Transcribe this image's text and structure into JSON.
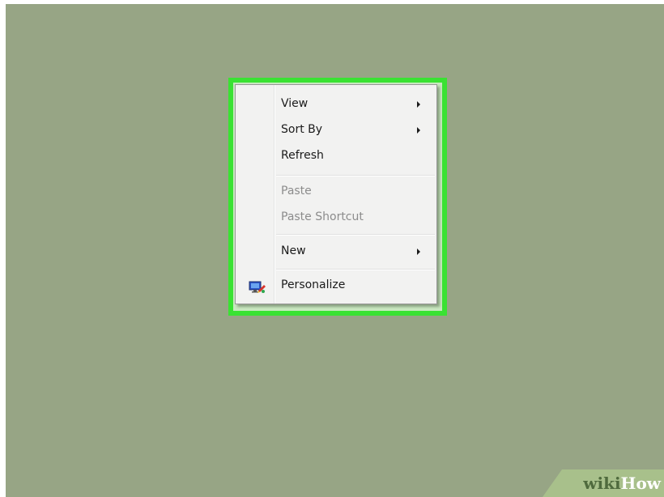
{
  "context_menu": {
    "items": [
      {
        "label": "View",
        "enabled": true,
        "submenu": true
      },
      {
        "label": "Sort By",
        "enabled": true,
        "submenu": true
      },
      {
        "label": "Refresh",
        "enabled": true,
        "submenu": false
      },
      {
        "label": "Paste",
        "enabled": false,
        "submenu": false
      },
      {
        "label": "Paste Shortcut",
        "enabled": false,
        "submenu": false
      },
      {
        "label": "New",
        "enabled": true,
        "submenu": true
      },
      {
        "label": "Personalize",
        "enabled": true,
        "submenu": false,
        "icon": "personalize-icon"
      }
    ]
  },
  "watermark": {
    "wiki": "wiki",
    "how": "How"
  },
  "colors": {
    "desktop": "#97a585",
    "highlight": "#3ae233",
    "menu_bg": "#f2f2f1",
    "disabled_text": "#8c8c8c"
  }
}
